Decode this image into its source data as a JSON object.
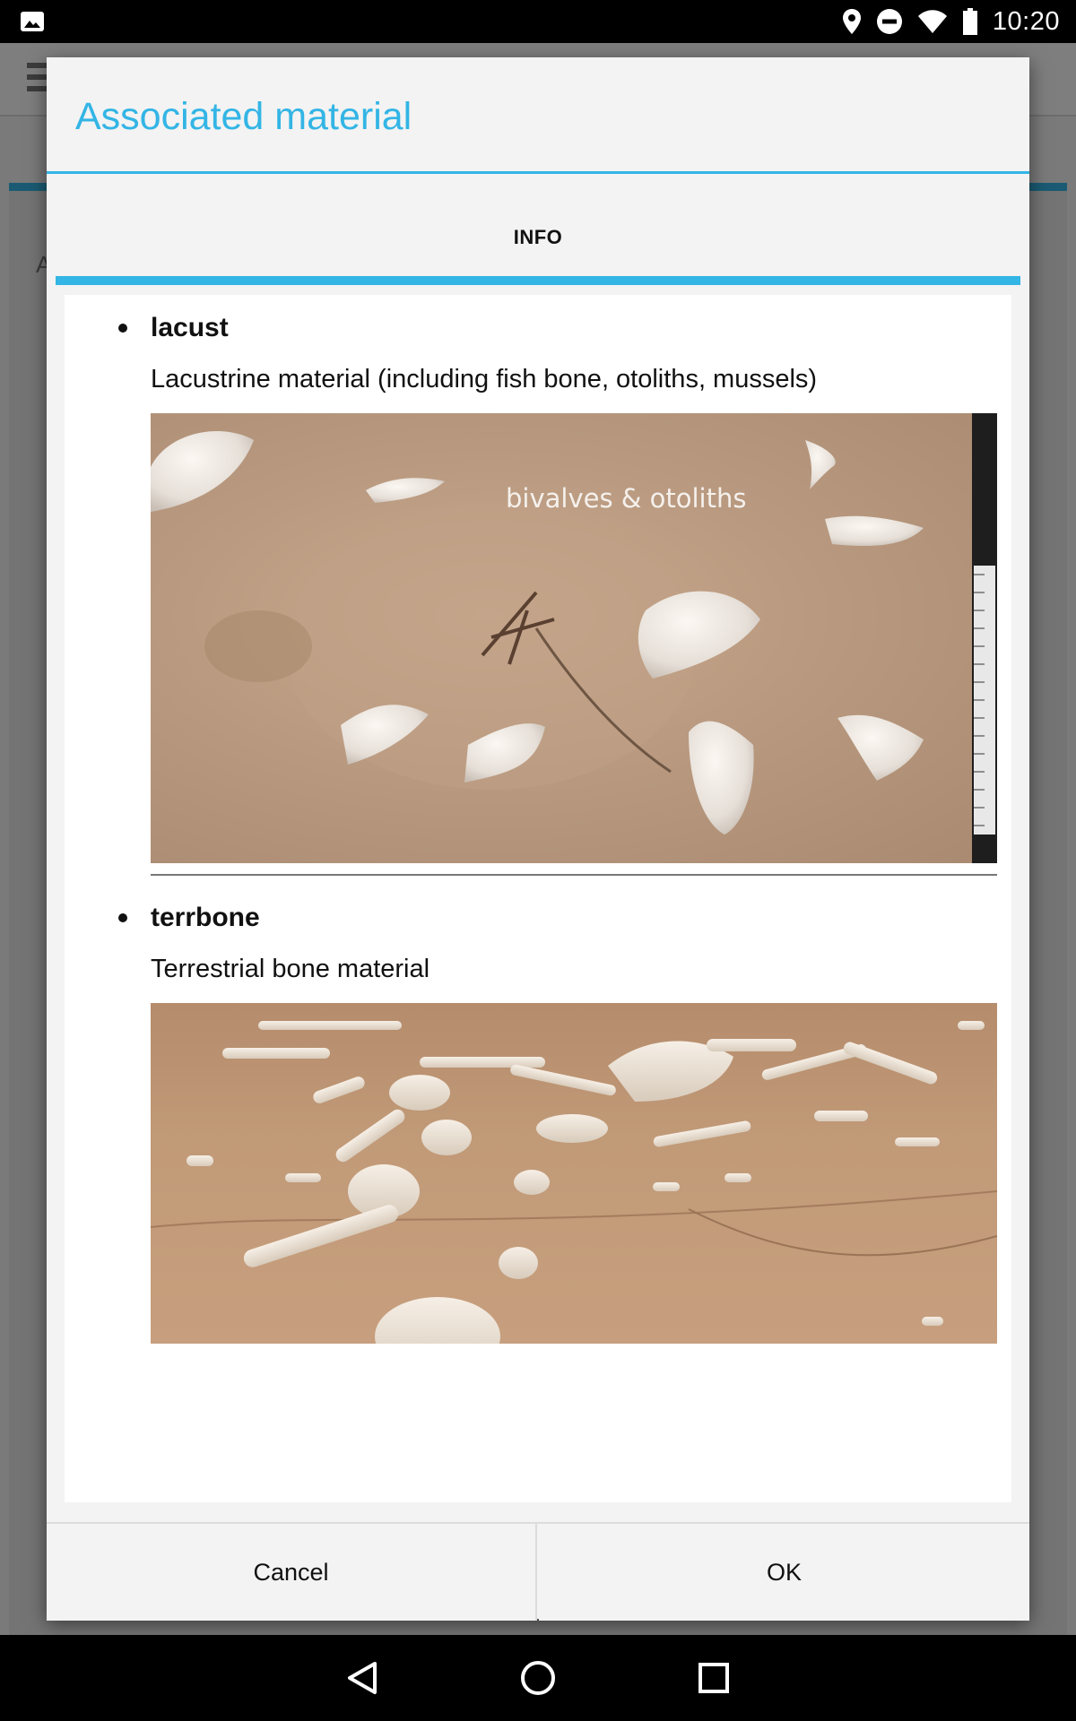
{
  "status_bar": {
    "time": "10:20",
    "icons": [
      "image-icon",
      "location-icon",
      "do-not-disturb-icon",
      "wifi-icon",
      "battery-icon"
    ]
  },
  "dialog": {
    "title": "Associated material",
    "tabs": [
      {
        "label": "INFO",
        "active": true
      }
    ],
    "accent_color": "#33b5e5",
    "items": [
      {
        "code": "lacust",
        "description": "Lacustrine material (including fish bone, otoliths, mussels)",
        "image_caption": "bivalves & otoliths"
      },
      {
        "code": "terrbone",
        "description": "Terrestrial bone material",
        "image_caption": ""
      }
    ],
    "buttons": {
      "cancel": "Cancel",
      "ok": "OK"
    }
  },
  "navigation": {
    "icons": [
      "back-icon",
      "home-icon",
      "recents-icon"
    ]
  }
}
